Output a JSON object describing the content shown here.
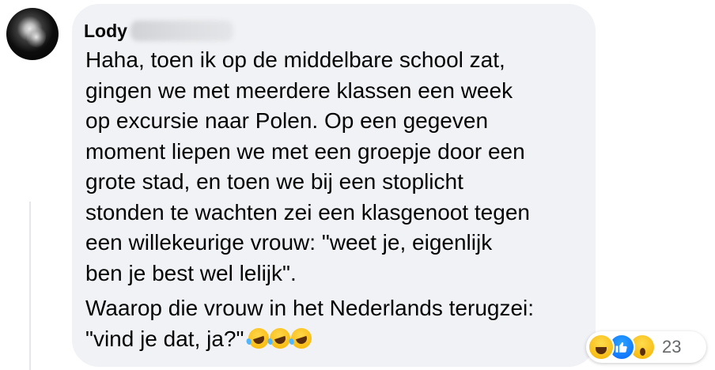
{
  "comment": {
    "author": "Lody",
    "paragraph1": "Haha, toen ik op de middelbare school zat,\ngingen we met meerdere klassen een week\nop excursie naar Polen. Op een gegeven\nmoment liepen we met een groepje door een\ngrote stad, en toen we bij een stoplicht\nstonden te wachten zei een klasgenoot tegen\neen willekeurige vrouw: \"weet je, eigenlijk\nben je best wel lelijk\".",
    "paragraph2": "Waarop die vrouw in het Nederlands terugzei:\n\"vind je dat, ja?\"",
    "trailing_emojis": [
      "rolling-on-floor-laughing",
      "rolling-on-floor-laughing",
      "rolling-on-floor-laughing"
    ]
  },
  "reactions": {
    "icons": [
      "haha",
      "like",
      "wow"
    ],
    "count": "23"
  },
  "colors": {
    "bubble": "#f0f2f5",
    "text": "#050505",
    "secondary": "#65676b",
    "like_blue": "#0866ff"
  }
}
